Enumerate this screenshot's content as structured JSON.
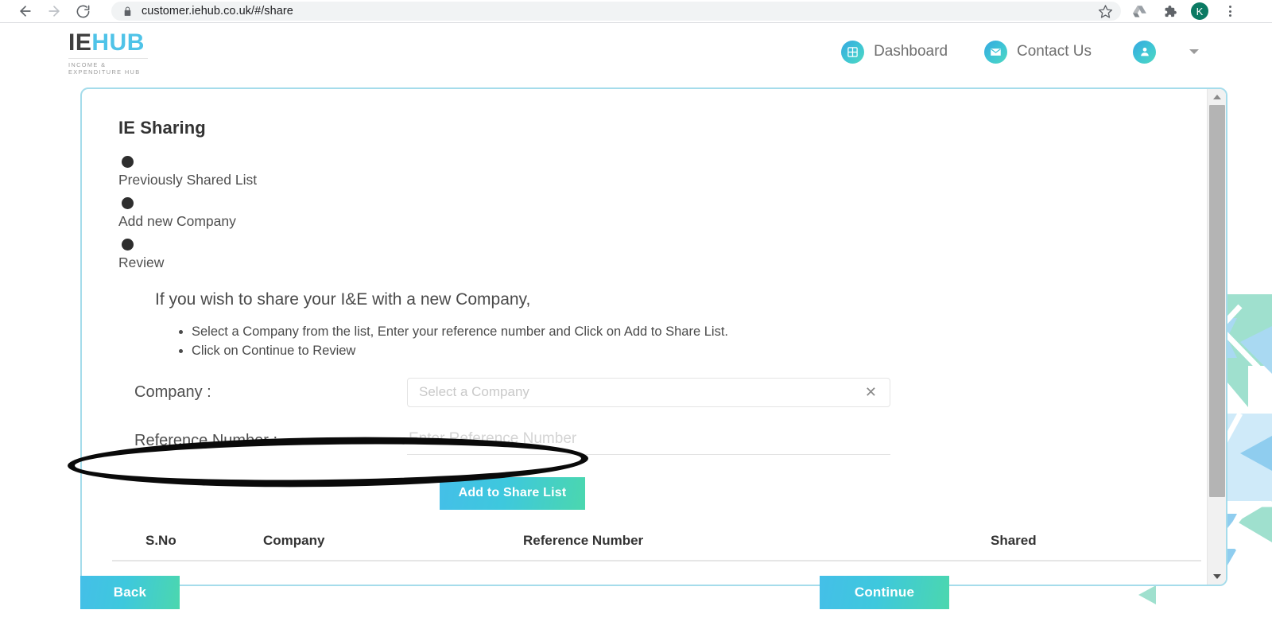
{
  "browser": {
    "url": "customer.iehub.co.uk/#/share",
    "back_label": "Back",
    "forward_label": "Forward",
    "reload_label": "Reload",
    "lock_label": "View site information",
    "bookmark_label": "Bookmark this tab",
    "drive_label": "Save to Google Drive",
    "extensions_label": "Extensions",
    "profile_initial": "K",
    "menu_label": "Customize and control Google Chrome"
  },
  "header": {
    "logo_primary": "IE",
    "logo_secondary": "HUB",
    "logo_subtitle": "INCOME & EXPENDITURE HUB",
    "nav": [
      {
        "label": "Dashboard",
        "icon": "dashboard-icon"
      },
      {
        "label": "Contact Us",
        "icon": "envelope-icon"
      }
    ],
    "account_icon": "user-avatar-icon",
    "account_caret": "chevron-down-icon"
  },
  "card": {
    "title": "IE Sharing",
    "steps": [
      {
        "label": "Previously Shared List"
      },
      {
        "label": "Add new Company"
      },
      {
        "label": "Review"
      }
    ],
    "intro": "If you wish to share your I&E with a new Company,",
    "bullets": [
      "Select a Company from the list, Enter your reference number and Click on Add to Share List.",
      "Click on Continue to Review"
    ],
    "form": {
      "company_label": "Company :",
      "company_value": "",
      "company_placeholder": "Select a Company",
      "company_clear_icon": "close-icon",
      "reference_label": "Reference Number :",
      "reference_value": "",
      "reference_placeholder": "Enter Reference Number"
    },
    "add_to_share_list_label": "Add to Share List",
    "table": {
      "columns": [
        "S.No",
        "Company",
        "Reference Number",
        "Shared"
      ],
      "rows": []
    }
  },
  "footer": {
    "back_label": "Back",
    "continue_label": "Continue"
  },
  "colors": {
    "brand_blue": "#4fc3e8",
    "brand_teal": "#4bd7ae",
    "card_border": "#a5dceb",
    "annotation": "#0a0a0a",
    "profile_badge": "#0b7a63"
  }
}
